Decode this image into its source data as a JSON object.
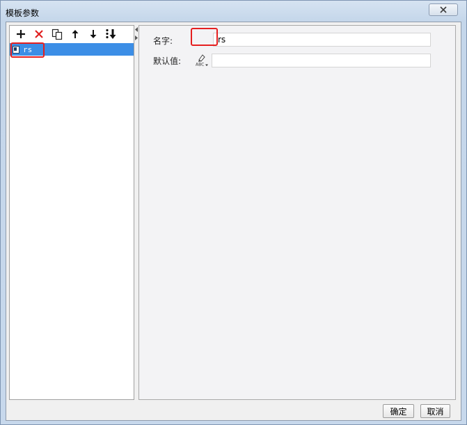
{
  "window": {
    "title": "模板参数"
  },
  "toolbar": {
    "icons": [
      "add-icon",
      "delete-icon",
      "copy-icon",
      "move-up-icon",
      "move-down-icon",
      "sort-icon"
    ]
  },
  "tree": {
    "items": [
      {
        "label": "rs",
        "selected": true
      }
    ]
  },
  "form": {
    "name_label": "名字:",
    "name_value": "rs",
    "default_label": "默认值:",
    "default_value": ""
  },
  "buttons": {
    "ok": "确定",
    "cancel": "取消"
  },
  "colors": {
    "selection": "#3c8ee6",
    "highlight_box": "#e51f1f",
    "delete_icon": "#e02020"
  }
}
